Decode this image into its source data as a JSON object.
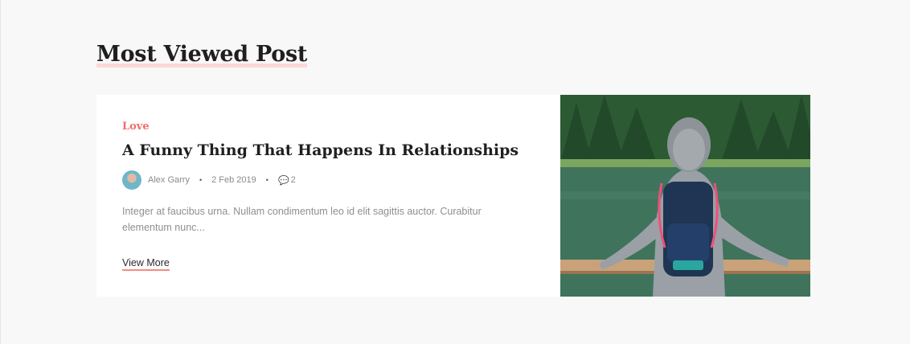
{
  "section": {
    "title": "Most Viewed Post"
  },
  "post": {
    "category": "Love",
    "title": "A Funny Thing That Happens In Relationships",
    "author": "Alex Garry",
    "date": "2 Feb 2019",
    "comments": "2",
    "excerpt": "Integer at faucibus urna. Nullam condimentum leo id elit sagittis auctor. Curabitur elementum nunc...",
    "cta": "View More"
  },
  "colors": {
    "accent": "#f06e6a",
    "underline": "#fbd9d5"
  }
}
